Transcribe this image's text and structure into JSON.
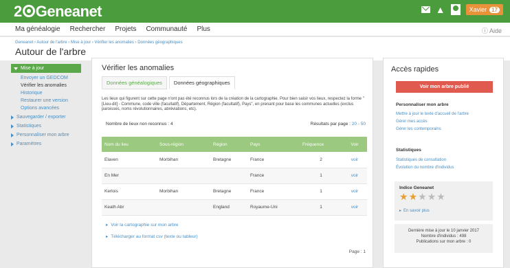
{
  "brand": {
    "prefix": "2",
    "suffix": "Geneanet"
  },
  "topbar": {
    "user_label": "Xavier",
    "user_count": "17"
  },
  "nav": {
    "items": [
      "Ma généalogie",
      "Rechercher",
      "Projets",
      "Communauté",
      "Plus"
    ],
    "help": "Aide"
  },
  "breadcrumb": "Geneanet › Autour de l'arbre › Mise à jour › Vérifier les anomalies › Données géographiques",
  "page_title": "Autour de l'arbre",
  "sidebar": {
    "active": "Mise à jour",
    "subitems": [
      "Envoyer un GEDCOM",
      "Vérifier les anomalies",
      "Historique",
      "Restaurer une version",
      "Options avancées"
    ],
    "items": [
      "Sauvegarder / exporter",
      "Statistiques",
      "Personnaliser mon arbre",
      "Paramètres"
    ]
  },
  "main": {
    "title": "Vérifier les anomalies",
    "tabs": [
      "Données généalogiques",
      "Données géographiques"
    ],
    "intro": "Les lieux qui figurent sur cette page n'ont pas été reconnus lors de la création de la cartographie. Pour bien saisir vos lieux, respectez la forme \"[Lieu-dit] - Commune, code ville (facultatif), Département, Région (facultatif), Pays\", en prenant pour base les communes actuelles (exclus paroisses, noms révolutionnaires, abréviations, etc).",
    "count_label": "Nombre de lieux non reconnus : 4",
    "per_page_label": "Résultats par page :",
    "per_page_options": "20 - 50",
    "columns": [
      "Nom du lieu",
      "Sous-région",
      "Région",
      "Pays",
      "Fréquence",
      "Voir"
    ],
    "rows": [
      [
        "Elaven",
        "Morbihan",
        "Bretagne",
        "France",
        "2",
        "voir"
      ],
      [
        "En Mer",
        "",
        "",
        "France",
        "1",
        "voir"
      ],
      [
        "Kerlois",
        "Morbihan",
        "Bretagne",
        "France",
        "1",
        "voir"
      ],
      [
        "Keath Abr",
        "",
        "England",
        "Royaume-Uni",
        "1",
        "voir"
      ]
    ],
    "links": [
      "Voir la cartographie sur mon arbre",
      "Télécharger au format csv (texte ou tableur)"
    ],
    "page": "Page : 1"
  },
  "aside": {
    "title": "Accès rapides",
    "publish_button": "Voir mon arbre publié",
    "section1_title": "Personnaliser mon arbre",
    "section1_links": [
      "Mettre à jour le texte d'accueil de l'arbre",
      "Gérer mes accès",
      "Gérer les contemporains"
    ],
    "section2_title": "Statistiques",
    "section2_links": [
      "Statistiques de consultation",
      "Évolution du nombre d'individus"
    ],
    "indice_title": "Indice Geneanet",
    "indice_stars": 2,
    "indice_more": "En savoir plus",
    "info_lines": [
      "Dernière mise à jour le 10 janvier 2017",
      "Nombre d'individus : 498",
      "Publications sur mon arbre : 0"
    ]
  }
}
